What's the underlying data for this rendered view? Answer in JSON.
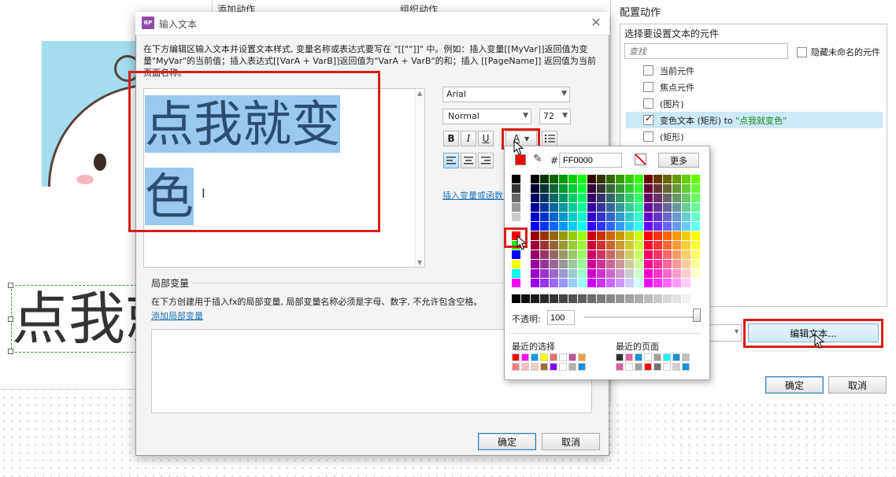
{
  "canvas": {
    "big_text": "点我就"
  },
  "bg_columns": {
    "add_action": "添加动作",
    "organize_action": "组织动作"
  },
  "config_panel": {
    "title": "配置动作",
    "subtitle": "选择要设置文本的元件",
    "search_placeholder": "查找",
    "hide_unnamed_label": "隐藏未命名的元件",
    "items": [
      {
        "label": "当前元件",
        "checked": false
      },
      {
        "label": "焦点元件",
        "checked": false
      },
      {
        "label": "(图片)",
        "checked": false
      },
      {
        "label_prefix": "变色文本 (矩形) to ",
        "label_highlight": "\"点我就变色\"",
        "checked": true
      },
      {
        "label": "(矩形)",
        "checked": false
      }
    ],
    "edit_text_button": "编辑文本...",
    "ok_button": "确定",
    "cancel_button": "取消"
  },
  "dialog": {
    "title": "输入文本",
    "logo_text": "RP",
    "close_glyph": "✕",
    "description": "在下方编辑区输入文本并设置文本样式, 变量名称或表达式要写在 \"[[\"\"]]\" 中。例如：插入变量[[MyVar]]返回值为变量\"MyVar\"的当前值；插入表达式[[VarA + VarB]]返回值为\"VarA + VarB\"的和；插入 [[PageName]] 返回值为当前页面名称。",
    "editor_text": "点我就变色",
    "font_family": "Arial",
    "font_style": "Normal",
    "font_size": "72",
    "bold_label": "B",
    "italic_label": "I",
    "underline_label": "U",
    "font_color_label": "A",
    "insert_link": "插入变量或函数...",
    "local_vars_header": "局部变量",
    "local_vars_desc": "在下方创建用于插入fx的局部变量, 局部变量名称必须是字母、数字, 不允许包含空格。",
    "add_local_var": "添加局部变量",
    "ok_button": "确定",
    "cancel_button": "取消"
  },
  "color_picker": {
    "current_color": "#FF0000",
    "hash_label": "#",
    "hex_value": "FF0000",
    "more_button": "更多",
    "opacity_label": "不透明:",
    "opacity_value": "100",
    "recent_selection_label": "最近的选择",
    "recent_page_label": "最近的页面",
    "recent_selection": [
      "#ff0000",
      "#ff00ff",
      "#00a0e0",
      "#ffff00",
      "#e07070",
      "#ffffff",
      "#c050a0",
      "#f0a040",
      "#f08080",
      "#ffc0c0",
      "#f4d0c0",
      "#a07030",
      "#8000ff",
      "#ffffff",
      "#b0b0b0",
      "#1a90d8"
    ],
    "recent_page": [
      "#303030",
      "#e060a0",
      "#1a90d8",
      "#ffffff",
      "#a0a0a0",
      "#00ffff",
      "#1a90d8",
      "#c0c0c0",
      "#e060a0",
      "#ffffff",
      "#a0a0a0",
      "#ff0000",
      "#707070",
      "#ffffff",
      "#d0d0d0",
      "#1a90d8"
    ]
  }
}
